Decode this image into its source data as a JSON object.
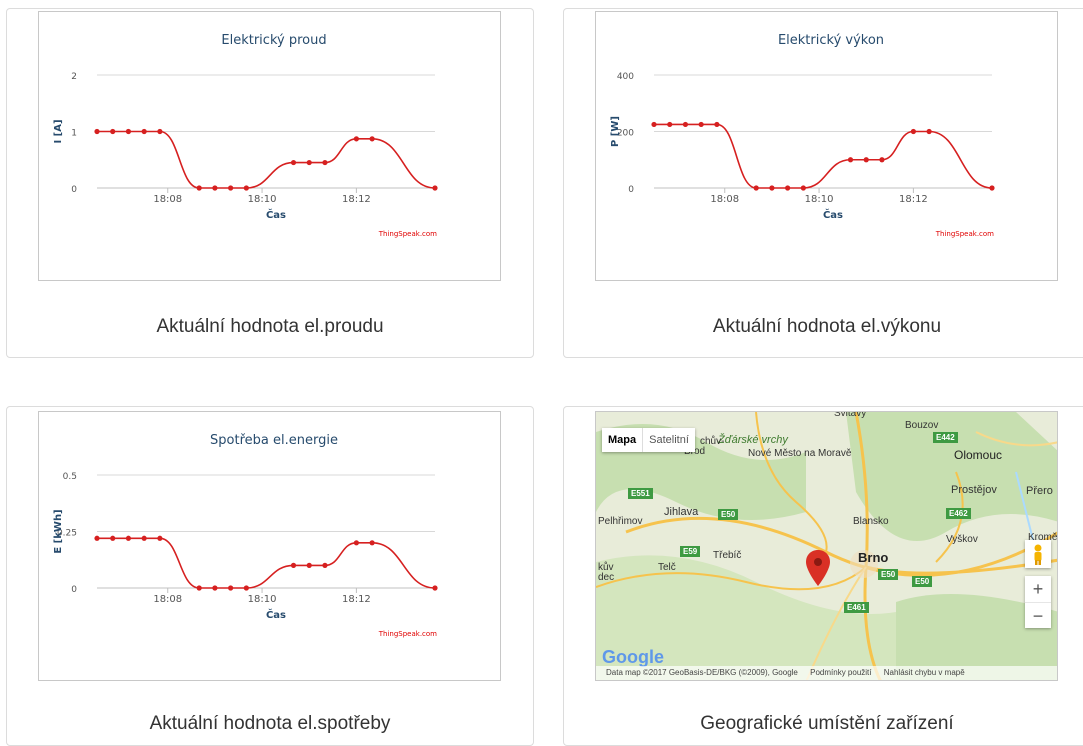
{
  "charts": [
    {
      "title": "Elektrický proud",
      "xlabel": "Čas",
      "ylabel": "I [A]",
      "yticks": [
        "0",
        "1",
        "2"
      ],
      "xticks": [
        "18:08",
        "18:10",
        "18:12"
      ],
      "credit": "ThingSpeak.com",
      "caption": "Aktuální hodnota el.proudu"
    },
    {
      "title": "Elektrický výkon",
      "xlabel": "Čas",
      "ylabel": "P [W]",
      "yticks": [
        "0",
        "200",
        "400"
      ],
      "xticks": [
        "18:08",
        "18:10",
        "18:12"
      ],
      "credit": "ThingSpeak.com",
      "caption": "Aktuální hodnota el.výkonu"
    },
    {
      "title": "Spotřeba el.energie",
      "xlabel": "Čas",
      "ylabel": "E [kWh]",
      "yticks": [
        "0",
        "0.25",
        "0.5"
      ],
      "xticks": [
        "18:08",
        "18:10",
        "18:12"
      ],
      "credit": "ThingSpeak.com",
      "caption": "Aktuální hodnota el.spotřeby"
    }
  ],
  "chart_data": [
    {
      "type": "line",
      "title": "Elektrický proud",
      "xlabel": "Čas",
      "ylabel": "I [A]",
      "ylim": [
        0,
        2
      ],
      "color": "#d62020",
      "x": [
        "18:06:30",
        "18:06:50",
        "18:07:10",
        "18:07:30",
        "18:07:50",
        "18:08:40",
        "18:09:00",
        "18:09:20",
        "18:09:40",
        "18:10:40",
        "18:11:00",
        "18:11:20",
        "18:12:00",
        "18:12:20",
        "18:13:40"
      ],
      "values": [
        1,
        1,
        1,
        1,
        1,
        0,
        0,
        0,
        0,
        0.45,
        0.45,
        0.45,
        0.87,
        0.87,
        0
      ]
    },
    {
      "type": "line",
      "title": "Elektrický výkon",
      "xlabel": "Čas",
      "ylabel": "P [W]",
      "ylim": [
        0,
        400
      ],
      "color": "#d62020",
      "x": [
        "18:06:30",
        "18:06:50",
        "18:07:10",
        "18:07:30",
        "18:07:50",
        "18:08:40",
        "18:09:00",
        "18:09:20",
        "18:09:40",
        "18:10:40",
        "18:11:00",
        "18:11:20",
        "18:12:00",
        "18:12:20",
        "18:13:40"
      ],
      "values": [
        225,
        225,
        225,
        225,
        225,
        0,
        0,
        0,
        0,
        100,
        100,
        100,
        200,
        200,
        0
      ]
    },
    {
      "type": "line",
      "title": "Spotřeba el.energie",
      "xlabel": "Čas",
      "ylabel": "E [kWh]",
      "ylim": [
        0,
        0.5
      ],
      "color": "#d62020",
      "x": [
        "18:06:30",
        "18:06:50",
        "18:07:10",
        "18:07:30",
        "18:07:50",
        "18:08:40",
        "18:09:00",
        "18:09:20",
        "18:09:40",
        "18:10:40",
        "18:11:00",
        "18:11:20",
        "18:12:00",
        "18:12:20",
        "18:13:40"
      ],
      "values": [
        0.22,
        0.22,
        0.22,
        0.22,
        0.22,
        0,
        0,
        0,
        0,
        0.1,
        0.1,
        0.1,
        0.2,
        0.2,
        0
      ]
    }
  ],
  "map": {
    "caption": "Geografické umístění zařízení",
    "map_button": "Mapa",
    "satellite_button": "Satelitní",
    "zoom_in": "+",
    "zoom_out": "−",
    "google_logo": "Google",
    "attribution": "Data map ©2017 GeoBasis-DE/BKG (©2009), Google",
    "terms": "Podmínky použití",
    "report": "Nahlásit chybu v mapě",
    "places": [
      "Žďárské vrchy",
      "Nové Město na Moravě",
      "Bouzov",
      "Olomouc",
      "Prostějov",
      "Přero",
      "Pelhřimov",
      "Jihlava",
      "Blansko",
      "Vyškov",
      "Kroměří",
      "Třebíč",
      "Telč",
      "Brno",
      "Brod",
      "kův",
      "chův-",
      "dec",
      "Svitavy"
    ],
    "roads": [
      "E442",
      "E551",
      "E50",
      "E462",
      "E59",
      "E50",
      "E50",
      "E461"
    ],
    "colors": {
      "water": "#aadaff",
      "land": "#e8ecd9",
      "forest": "#c7dfb0",
      "road": "#f6c34d",
      "pin": "#d93025"
    }
  }
}
